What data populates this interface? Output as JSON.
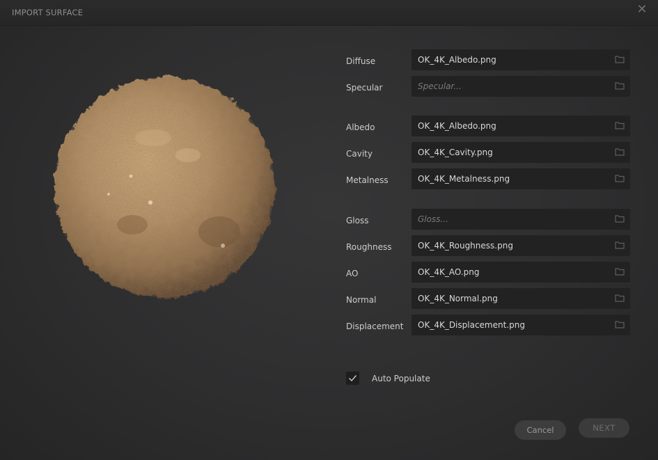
{
  "window": {
    "title": "IMPORT SURFACE",
    "close_icon": "close-icon"
  },
  "preview": {
    "icon": "surface-preview-sphere",
    "color": "#b38f64"
  },
  "fields": [
    {
      "key": "diffuse",
      "label": "Diffuse",
      "value": "OK_4K_Albedo.png",
      "placeholder": ""
    },
    {
      "key": "specular",
      "label": "Specular",
      "value": "",
      "placeholder": "Specular..."
    },
    {
      "key": "albedo",
      "label": "Albedo",
      "value": "OK_4K_Albedo.png",
      "placeholder": ""
    },
    {
      "key": "cavity",
      "label": "Cavity",
      "value": "OK_4K_Cavity.png",
      "placeholder": ""
    },
    {
      "key": "metalness",
      "label": "Metalness",
      "value": "OK_4K_Metalness.png",
      "placeholder": ""
    },
    {
      "key": "gloss",
      "label": "Gloss",
      "value": "",
      "placeholder": "Gloss..."
    },
    {
      "key": "roughness",
      "label": "Roughness",
      "value": "OK_4K_Roughness.png",
      "placeholder": ""
    },
    {
      "key": "ao",
      "label": "AO",
      "value": "OK_4K_AO.png",
      "placeholder": ""
    },
    {
      "key": "normal",
      "label": "Normal",
      "value": "OK_4K_Normal.png",
      "placeholder": ""
    },
    {
      "key": "displacement",
      "label": "Displacement",
      "value": "OK_4K_Displacement.png",
      "placeholder": ""
    }
  ],
  "auto_populate": {
    "label": "Auto Populate",
    "checked": true
  },
  "buttons": {
    "cancel": "Cancel",
    "next": "NEXT"
  }
}
